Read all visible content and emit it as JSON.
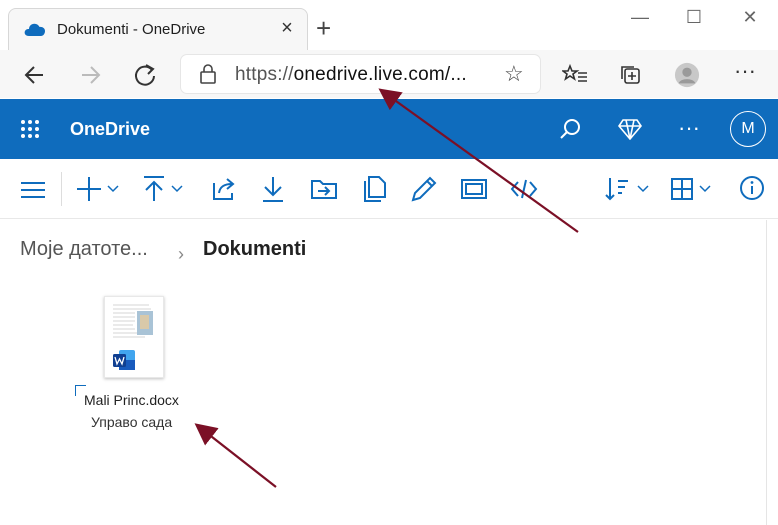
{
  "browser": {
    "tab_title": "Dokumenti - OneDrive",
    "url_scheme": "https://",
    "url_host": "onedrive.live.com/...",
    "icons": [
      "onedrive-cloud-icon",
      "close-icon",
      "plus-icon",
      "minimize-icon",
      "maximize-icon",
      "window-close-icon",
      "back-icon",
      "forward-icon",
      "refresh-icon",
      "lock-icon",
      "star-icon",
      "favorites-icon",
      "collections-icon",
      "profile-icon",
      "more-icon"
    ]
  },
  "onedrive": {
    "app_name": "OneDrive",
    "avatar_initial": "M",
    "brand_color": "#0f6cbd"
  },
  "breadcrumb": {
    "parent": "Моје датоте...",
    "separator": "›",
    "current": "Dokumenti"
  },
  "files": [
    {
      "name": "Mali Princ.docx",
      "modified": "Управо сада",
      "icon": "word-icon"
    }
  ]
}
